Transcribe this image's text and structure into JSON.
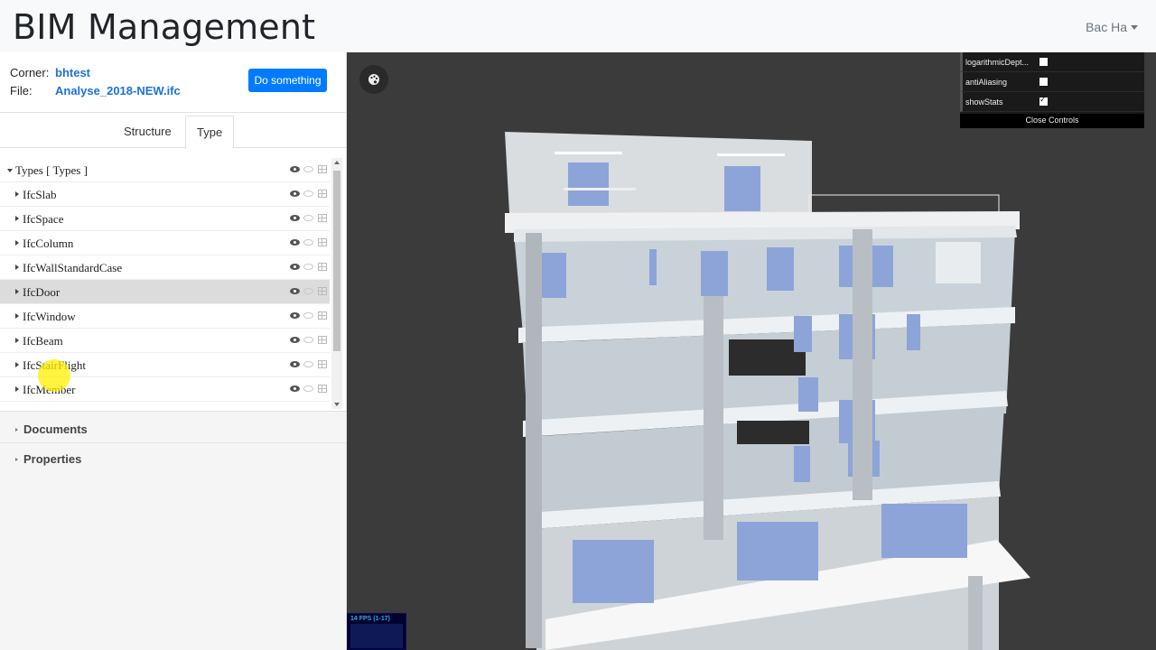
{
  "app": {
    "title": "BIM Management",
    "user": "Bac Ha"
  },
  "info": {
    "corner_label": "Corner:",
    "corner_value": "bhtest",
    "file_label": "File:",
    "file_value": "Analyse_2018-NEW.ifc",
    "action_label": "Do something"
  },
  "tabs": [
    {
      "label": "Structure",
      "active": false
    },
    {
      "label": "Type",
      "active": true
    }
  ],
  "tree": {
    "root": "Types [ Types ]",
    "items": [
      {
        "label": "IfcSlab"
      },
      {
        "label": "IfcSpace"
      },
      {
        "label": "IfcColumn"
      },
      {
        "label": "IfcWallStandardCase"
      },
      {
        "label": "IfcDoor",
        "selected": true
      },
      {
        "label": "IfcWindow"
      },
      {
        "label": "IfcBeam"
      },
      {
        "label": "IfcStairFlight"
      },
      {
        "label": "IfcMember"
      }
    ]
  },
  "sections": {
    "documents": "Documents",
    "properties": "Properties"
  },
  "controls": {
    "items": [
      {
        "name": "logarithmicDept...",
        "checked": false
      },
      {
        "name": "antiAliasing",
        "checked": false
      },
      {
        "name": "showStats",
        "checked": true
      }
    ],
    "close_label": "Close Controls"
  },
  "stats": {
    "fps": "14 FPS (1-17)"
  },
  "colors": {
    "accent": "#007bff",
    "link": "#1a73d9",
    "viewer_bg": "#3b3b3b"
  },
  "icons": {
    "palette": "palette-icon",
    "visible": "eye-icon",
    "hidden": "eye-off-icon",
    "table": "table-icon"
  }
}
